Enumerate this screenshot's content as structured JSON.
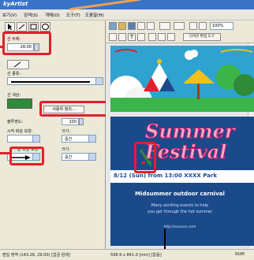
{
  "window": {
    "title": "kyArtist"
  },
  "menu": {
    "items": [
      "보기(V)",
      "검색(S)",
      "개체(O)",
      "도구(T)",
      "도움말(H)"
    ]
  },
  "panel": {
    "line_width_label": "선 두께:",
    "line_width_value": "28.00",
    "line_type_label": "선 종류:",
    "line_color_label": "선 색상:",
    "custom_color_button": "사용자 정의...",
    "opacity_label": "불투명도:",
    "opacity_value": "100",
    "start_arrow_label": "시작 화살 모양:",
    "end_arrow_label": "끝 화살 모양:",
    "size_label_1": "크기:",
    "size_label_2": "크기:",
    "size_value_1": "중간",
    "size_value_2": "중간",
    "line_color_hex": "#2f8a3a"
  },
  "toolbar": {
    "zoom": "100%",
    "text_button": "디자인 편집 도구"
  },
  "poster": {
    "title_line1": "Summer",
    "title_line2": "Festival",
    "date_line": "8/12 (Sun) from 13:00  XXXX Park",
    "subtitle": "Midsummer outdoor carnival",
    "desc_line1": "Many exciting events to help",
    "desc_line2": "you get through the hot summer",
    "url": "http://xxxxxx.com"
  },
  "status": {
    "coords": "편집 영역 (143.26, 29.00) [업글 원래]",
    "size": "598.9 x 841.0 [mm] [없음]",
    "mode": "NUM"
  },
  "colors": {
    "accent": "#e0202c",
    "title_pink": "#c3186c",
    "title_fill": "#f7a9c9",
    "panel_bg": "#ece9d8"
  }
}
